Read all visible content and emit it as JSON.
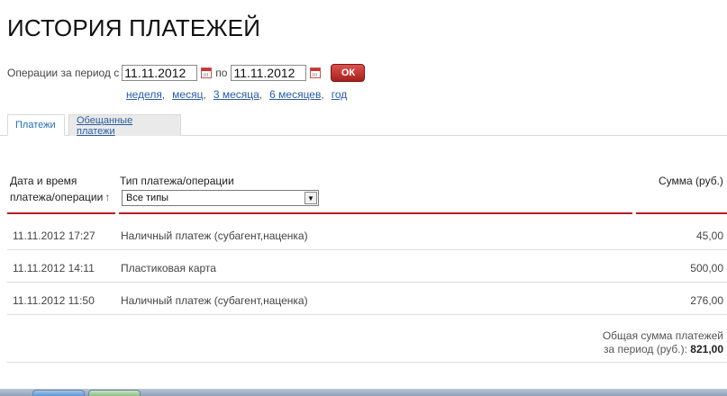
{
  "page": {
    "title": "ИСТОРИЯ ПЛАТЕЖЕЙ"
  },
  "period": {
    "label": "Операции за период с",
    "date_from": "11.11.2012",
    "to_label": "по",
    "date_to": "11.11.2012",
    "ok_label": "ОК",
    "quick_links": [
      "неделя",
      "месяц",
      "3 месяца",
      "6 месяцев",
      "год"
    ]
  },
  "tabs": [
    {
      "label": "Платежи",
      "active": true
    },
    {
      "label": "Обещанные платежи",
      "active": false
    }
  ],
  "table": {
    "headers": {
      "date_line1": "Дата и время",
      "date_line2": "платежа/операции",
      "sort_arrow": "↑",
      "type": "Тип платежа/операции",
      "sum": "Сумма (руб.)"
    },
    "type_filter": "Все типы",
    "rows": [
      {
        "date": "11.11.2012 17:27",
        "type": "Наличный платеж (субагент,наценка)",
        "sum": "45,00"
      },
      {
        "date": "11.11.2012 14:11",
        "type": "Пластиковая карта",
        "sum": "500,00"
      },
      {
        "date": "11.11.2012 11:50",
        "type": "Наличный платеж (субагент,наценка)",
        "sum": "276,00"
      }
    ],
    "total_line1": "Общая сумма платежей",
    "total_line2": "за период (руб.):",
    "total_value": "821,00"
  },
  "colors": {
    "accent": "#b81c23",
    "link": "#2a5d9f",
    "ok_button": "#c0302b"
  },
  "icons": {
    "calendar": "calendar-icon",
    "dropdown": "chevron-down-icon"
  }
}
